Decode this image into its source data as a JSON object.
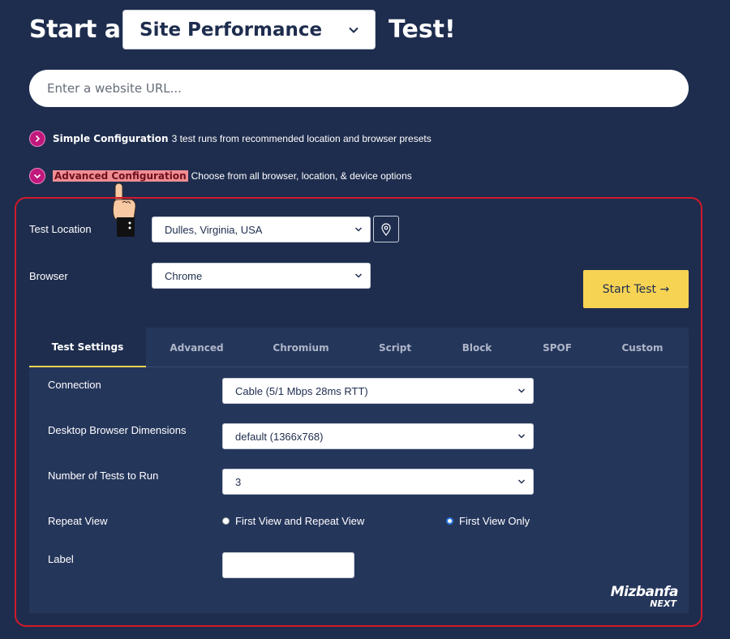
{
  "header": {
    "prefix": "Start a",
    "test_type": "Site Performance",
    "suffix": "Test!"
  },
  "url_input": {
    "placeholder": "Enter a website URL..."
  },
  "simple_config": {
    "title": "Simple Configuration",
    "description": "3 test runs from recommended location and browser presets"
  },
  "advanced_config": {
    "title": "Advanced Configuration",
    "description": "Choose from all browser, location, & device options"
  },
  "location": {
    "label": "Test Location",
    "value": "Dulles, Virginia, USA"
  },
  "browser": {
    "label": "Browser",
    "value": "Chrome"
  },
  "start_button": {
    "label": "Start Test →"
  },
  "tabs": [
    {
      "label": "Test Settings",
      "active": true
    },
    {
      "label": "Advanced"
    },
    {
      "label": "Chromium"
    },
    {
      "label": "Script"
    },
    {
      "label": "Block"
    },
    {
      "label": "SPOF"
    },
    {
      "label": "Custom"
    }
  ],
  "settings": {
    "connection": {
      "label": "Connection",
      "value": "Cable (5/1 Mbps 28ms RTT)"
    },
    "dimensions": {
      "label": "Desktop Browser Dimensions",
      "value": "default (1366x768)"
    },
    "num_tests": {
      "label": "Number of Tests to Run",
      "value": "3"
    },
    "repeat_view": {
      "label": "Repeat View",
      "options": [
        {
          "label": "First View and Repeat View",
          "selected": false
        },
        {
          "label": "First View Only",
          "selected": true
        }
      ]
    },
    "label_field": {
      "label": "Label",
      "value": ""
    }
  },
  "brand": {
    "name": "Mizbanfa",
    "sub": "NEXT"
  },
  "colors": {
    "background": "#1e2d4e",
    "panel": "#25365b",
    "accent_yellow": "#f7d354",
    "magenta": "#c1187d",
    "highlight_border": "#d11a2a"
  },
  "icons": [
    "chevron-down-icon",
    "chevron-right-icon",
    "map-pin-icon",
    "pointing-hand-icon",
    "arrow-right-icon"
  ]
}
